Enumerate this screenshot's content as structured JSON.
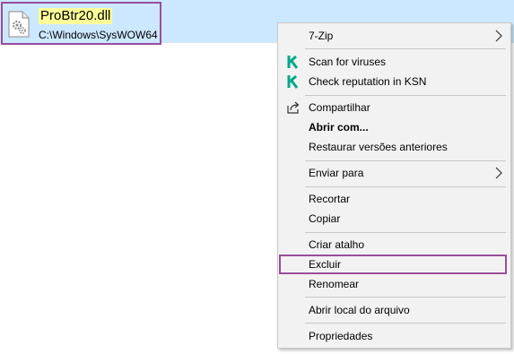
{
  "file": {
    "name": "ProBtr20.dll",
    "path": "C:\\Windows\\SysWOW64",
    "icon": "dll-file-icon"
  },
  "menu": {
    "items": [
      {
        "label": "7-Zip",
        "has_submenu": true
      },
      {
        "label": "Scan for viruses",
        "icon": "kaspersky-icon"
      },
      {
        "label": "Check reputation in KSN",
        "icon": "kaspersky-icon"
      },
      {
        "label": "Compartilhar",
        "icon": "share-icon"
      },
      {
        "label": "Abrir com...",
        "bold": true
      },
      {
        "label": "Restaurar versões anteriores"
      },
      {
        "label": "Enviar para",
        "has_submenu": true
      },
      {
        "label": "Recortar"
      },
      {
        "label": "Copiar"
      },
      {
        "label": "Criar atalho"
      },
      {
        "label": "Excluir",
        "highlighted": true
      },
      {
        "label": "Renomear"
      },
      {
        "label": "Abrir local do arquivo"
      },
      {
        "label": "Propriedades"
      }
    ]
  },
  "colors": {
    "selection_bg": "#cce8ff",
    "highlight_border": "#9a4d9a",
    "filename_highlight": "#ffff99",
    "kaspersky_green": "#00a88e",
    "menu_bg": "#f2f2f2"
  }
}
